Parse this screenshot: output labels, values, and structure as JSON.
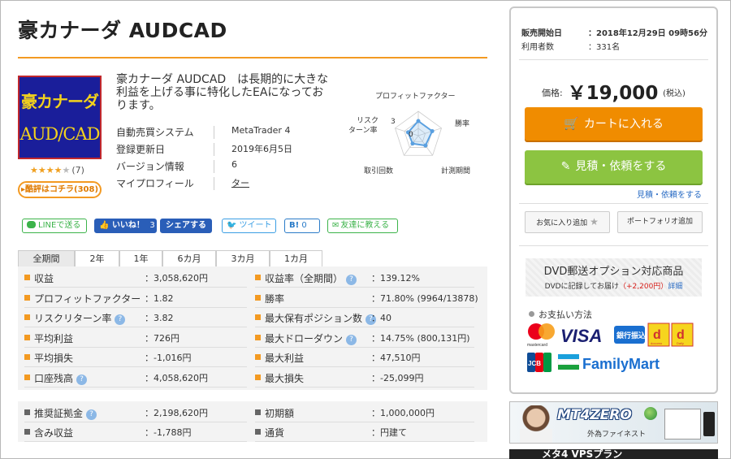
{
  "header": {
    "title": "豪カナーダ AUDCAD"
  },
  "product": {
    "image_line1": "豪カナーダ",
    "image_line2": "AUD/CAD",
    "rating": 4,
    "rating_max": 5,
    "review_count": "(7)",
    "review_button": "酷評はコチラ(308)",
    "description": "豪カナーダ AUDCAD　は長期的に大きな利益を上げる事に特化したEAになっております。",
    "specs": [
      {
        "key": "自動売買システム",
        "value": "MetaTrader 4"
      },
      {
        "key": "登録更新日",
        "value": "2019年6月5日"
      },
      {
        "key": "バージョン情報",
        "value": "6"
      },
      {
        "key": "マイプロフィール",
        "value": "ター"
      }
    ]
  },
  "radar": {
    "labels": [
      "プロフィットファクター",
      "勝率",
      "計測期間",
      "取引回数",
      "リスク\nターン率"
    ],
    "label_a": "リスク",
    "label_b": "ターン率",
    "values": [
      3.0,
      3.0,
      2.5,
      2.0,
      2.2
    ],
    "max": 5,
    "tick_3": "3",
    "tick_0": "0"
  },
  "social": {
    "line": "LINEで送る",
    "like": "いいね！",
    "like_count": "3",
    "share": "シェアする",
    "tweet": "ツイート",
    "hatena": "B!",
    "hatena_count": "0",
    "friend": "友達に教える"
  },
  "tabs": [
    {
      "label": "全期間",
      "active": true
    },
    {
      "label": "2年"
    },
    {
      "label": "1年"
    },
    {
      "label": "6カ月"
    },
    {
      "label": "3カ月"
    },
    {
      "label": "1カ月"
    }
  ],
  "stats": {
    "left": [
      {
        "label": "収益",
        "value": "：3,058,620円",
        "q": false
      },
      {
        "label": "プロフィットファクター",
        "value": "：1.82",
        "q": false
      },
      {
        "label": "リスクリターン率",
        "value": "：3.82",
        "q": true
      },
      {
        "label": "平均利益",
        "value": "：726円",
        "q": false
      },
      {
        "label": "平均損失",
        "value": "：-1,016円",
        "q": false
      },
      {
        "label": "口座残高",
        "value": "：4,058,620円",
        "q": true
      }
    ],
    "right": [
      {
        "label": "収益率（全期間）",
        "value": "：139.12%",
        "q": true
      },
      {
        "label": "勝率",
        "value": "：71.80% (9964/13878)",
        "q": false
      },
      {
        "label": "最大保有ポジション数",
        "value": "：40",
        "q": true
      },
      {
        "label": "最大ドローダウン",
        "value": "：14.75% (800,131円)",
        "q": true
      },
      {
        "label": "最大利益",
        "value": "：47,510円",
        "q": false
      },
      {
        "label": "最大損失",
        "value": "：-25,099円",
        "q": false
      }
    ]
  },
  "stats2": {
    "left": [
      {
        "label": "推奨証拠金",
        "value": "：2,198,620円",
        "q": true
      },
      {
        "label": "含み収益",
        "value": "：-1,788円",
        "q": false
      }
    ],
    "right": [
      {
        "label": "初期額",
        "value": "：1,000,000円",
        "q": false
      },
      {
        "label": "通貨",
        "value": "：円建て",
        "q": false
      }
    ]
  },
  "sidebar": {
    "sale_start_label": "販売開始日",
    "sale_start_value": "：2018年12月29日 09時56分",
    "users_label": "利用者数",
    "users_value": "：331名",
    "price_label": "価格:",
    "price_value": "￥19,000",
    "price_tax": "(税込)",
    "cart_button": "カートに入れる",
    "quote_button": "見積・依頼をする",
    "quote_link": "見積・依頼をする",
    "favorite_button": "お気に入り追加",
    "portfolio_button": "ポートフォリオ追加",
    "dvd_title": "DVD郵送オプション対応商品",
    "dvd_desc": "DVDに記録してお届け",
    "dvd_price": "（+2,200円）",
    "dvd_link": "詳細",
    "payment_title": "お支払い方法",
    "payment": {
      "mastercard": "mastercard",
      "visa": "VISA",
      "bank": "銀行振込",
      "d1": "d",
      "d2": "d",
      "d_label": "docomo",
      "d_label2": "Daily",
      "jcb": "JCB",
      "familymart": "FamilyMart"
    }
  },
  "banner1": {
    "title": "MT4ZERO",
    "sub": "外為ファイネスト"
  },
  "banner2": {
    "title": "メタ4 VPSプラン"
  },
  "colors": {
    "accent": "#f39a22",
    "cart": "#f08c00",
    "quote": "#8cc441",
    "link": "#2a6cc4",
    "fb": "#2a5eb8"
  }
}
